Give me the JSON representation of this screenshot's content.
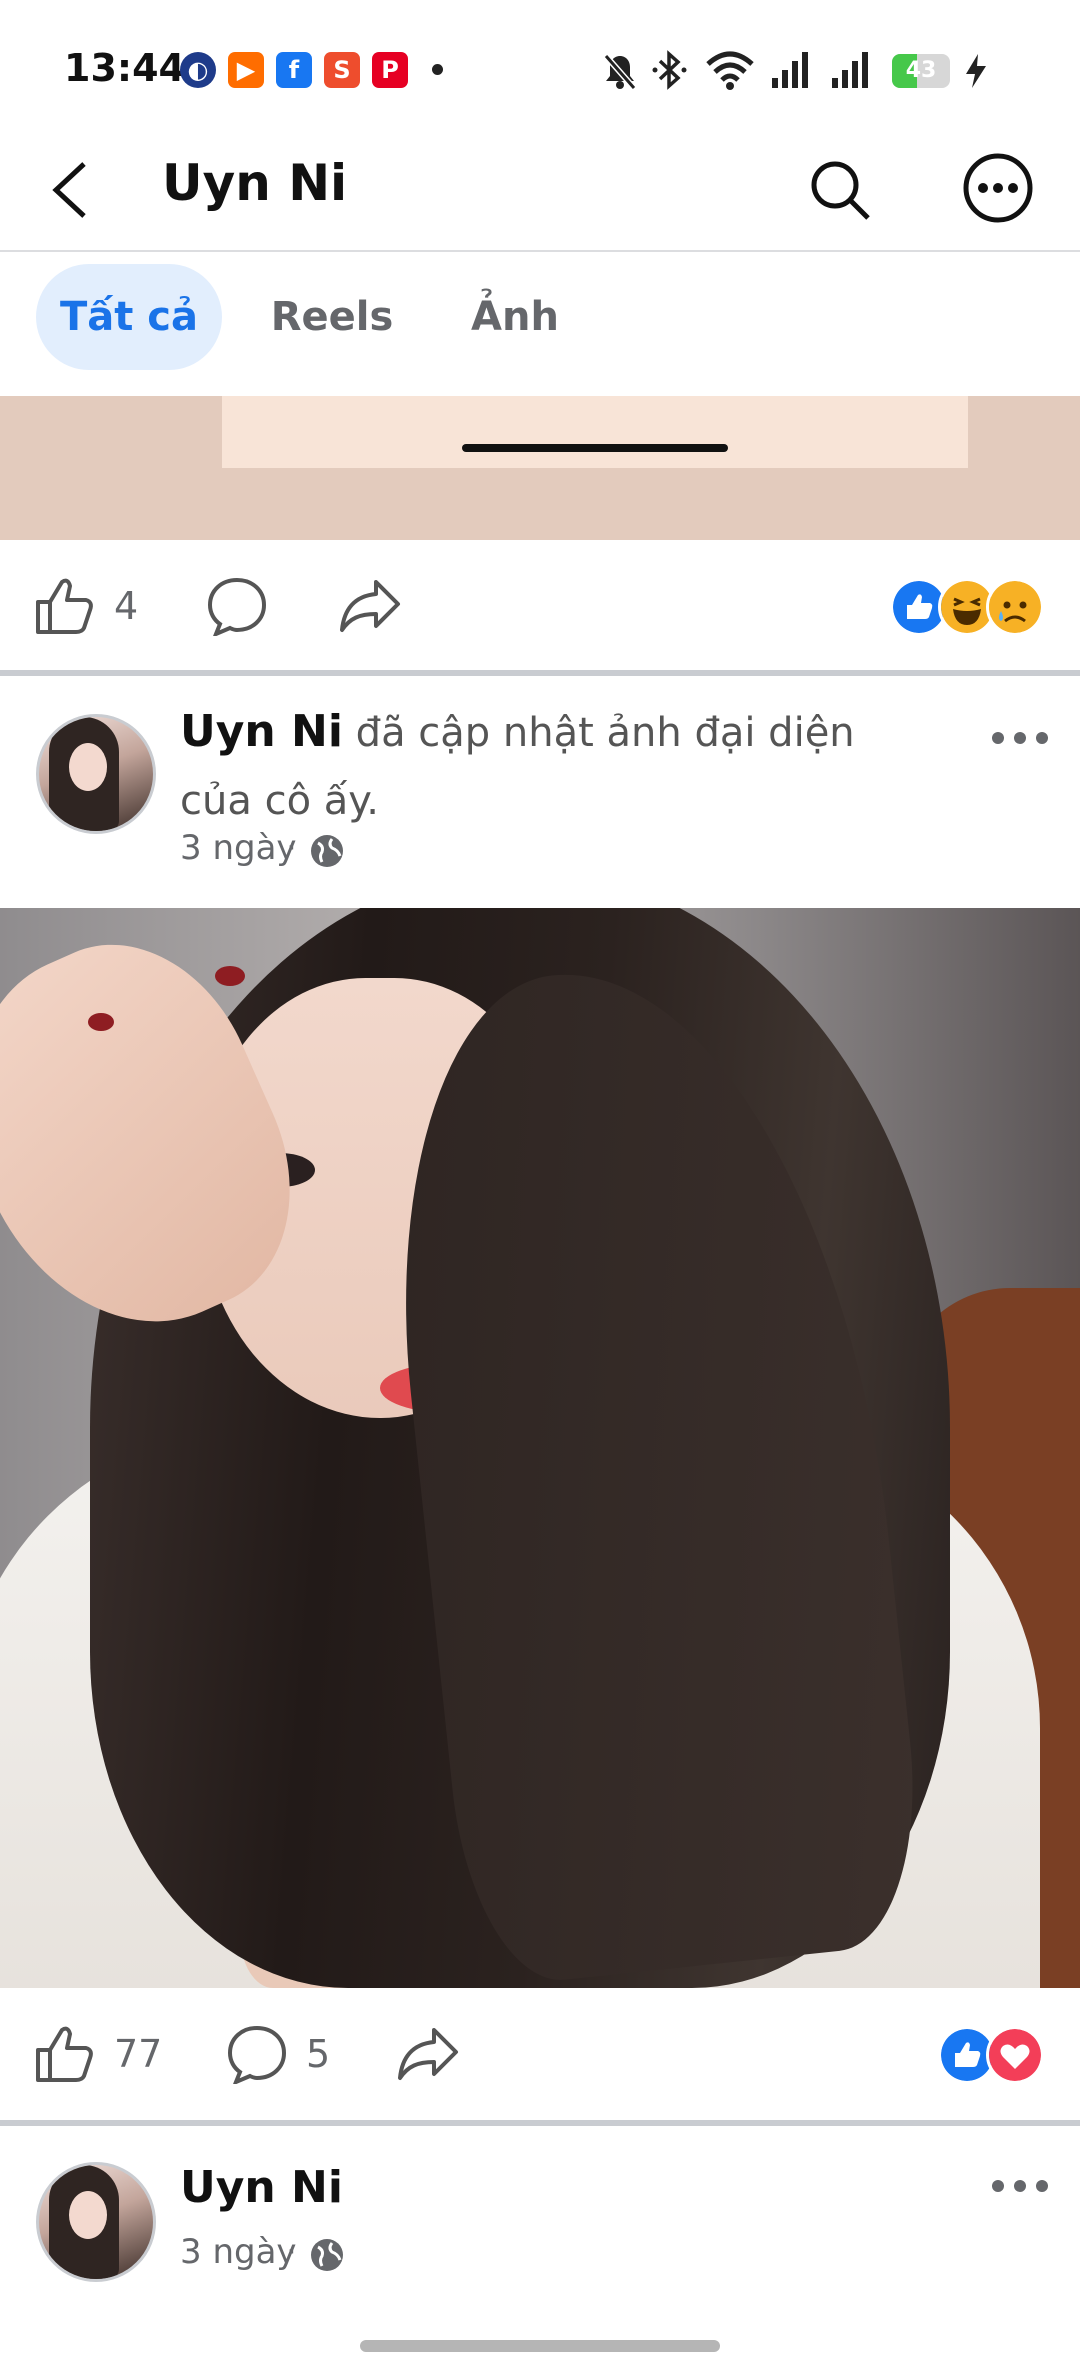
{
  "status_bar": {
    "time": "13:44",
    "battery": "43",
    "battery_level": 0.43
  },
  "header": {
    "title": "Uyn Ni",
    "back_icon": "chevron-left-icon",
    "search_icon": "search-icon",
    "more_icon": "more-horizontal-icon"
  },
  "tabs": [
    {
      "label": "Tất cả",
      "active": true
    },
    {
      "label": "Reels",
      "active": false
    },
    {
      "label": "Ảnh",
      "active": false
    }
  ],
  "post1": {
    "like_count": "4",
    "reactions": [
      "like",
      "haha",
      "sad"
    ]
  },
  "post2": {
    "author": "Uyn Ni",
    "action": " đã cập nhật ảnh đại diện của cô ấy.",
    "time": "3 ngày",
    "privacy_icon": "globe-icon",
    "like_count": "77",
    "comment_count": "5",
    "reactions": [
      "like",
      "love"
    ]
  },
  "post3": {
    "author": "Uyn Ni",
    "time": "3 ngày",
    "privacy_icon": "globe-icon"
  },
  "colors": {
    "accent": "#1a73e8",
    "tab_active_bg": "#e2eefd",
    "like_blue": "#1877f2",
    "love_red": "#f33e58"
  }
}
